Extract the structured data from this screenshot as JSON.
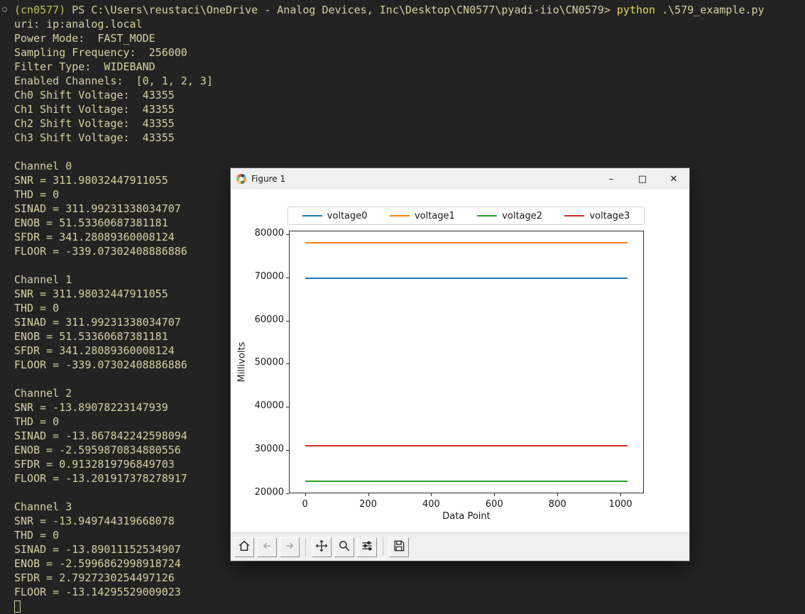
{
  "terminal": {
    "prompt": {
      "env": "(cn0577)",
      "path": "PS C:\\Users\\reustaci\\OneDrive - Analog Devices, Inc\\Desktop\\CN0577\\pyadi-iio\\CN0579>",
      "command": "python",
      "argument": ".\\579_example.py"
    },
    "output_lines": [
      "uri: ip:analog.local",
      "Power Mode:  FAST_MODE",
      "Sampling Frequency:  256000",
      "Filter Type:  WIDEBAND",
      "Enabled Channels:  [0, 1, 2, 3]",
      "Ch0 Shift Voltage:  43355",
      "Ch1 Shift Voltage:  43355",
      "Ch2 Shift Voltage:  43355",
      "Ch3 Shift Voltage:  43355",
      "",
      "Channel 0",
      "SNR = 311.98032447911055",
      "THD = 0",
      "SINAD = 311.99231338034707",
      "ENOB = 51.53360687381181",
      "SFDR = 341.28089360008124",
      "FLOOR = -339.07302408886886",
      "",
      "Channel 1",
      "SNR = 311.98032447911055",
      "THD = 0",
      "SINAD = 311.99231338034707",
      "ENOB = 51.53360687381181",
      "SFDR = 341.28089360008124",
      "FLOOR = -339.07302408886886",
      "",
      "Channel 2",
      "SNR = -13.89078223147939",
      "THD = 0",
      "SINAD = -13.867842242598094",
      "ENOB = -2.5959870834880556",
      "SFDR = 0.9132819796849703",
      "FLOOR = -13.201917378278917",
      "",
      "Channel 3",
      "SNR = -13.949744319668078",
      "THD = 0",
      "SINAD = -13.89011152534907",
      "ENOB = -2.5996862998918724",
      "SFDR = 2.7927230254497126",
      "FLOOR = -13.14295529009023"
    ]
  },
  "figure_window": {
    "title": "Figure 1",
    "window_controls": {
      "minimize": "–",
      "maximize": "□",
      "close": "✕"
    },
    "toolbar_buttons": [
      {
        "name": "home",
        "enabled": true
      },
      {
        "name": "back",
        "enabled": false
      },
      {
        "name": "forward",
        "enabled": false
      },
      {
        "name": "pan",
        "enabled": true
      },
      {
        "name": "zoom",
        "enabled": true
      },
      {
        "name": "configure-subplots",
        "enabled": true
      },
      {
        "name": "save",
        "enabled": true
      }
    ]
  },
  "chart_data": {
    "type": "line",
    "title": "",
    "xlabel": "Data Point",
    "ylabel": "Millivolts",
    "xlim": [
      -51,
      1074
    ],
    "ylim": [
      19930,
      80870
    ],
    "xticks": [
      0,
      200,
      400,
      600,
      800,
      1000
    ],
    "yticks": [
      20000,
      30000,
      40000,
      50000,
      60000,
      70000,
      80000
    ],
    "x_range": [
      0,
      1023
    ],
    "grid": false,
    "legend_position": "upper center, above axes",
    "series": [
      {
        "name": "voltage0",
        "color": "#1f77b4",
        "value": 69900
      },
      {
        "name": "voltage1",
        "color": "#ff7f0e",
        "value": 78100
      },
      {
        "name": "voltage2",
        "color": "#2ca02c",
        "value": 22700
      },
      {
        "name": "voltage3",
        "color": "#d62728",
        "value": 30900
      }
    ]
  },
  "colors": {
    "terminal_background": "#232323",
    "terminal_foreground": "#d5d1a2",
    "prompt_env": "#b9c24d",
    "prompt_command": "#e5d44e"
  }
}
